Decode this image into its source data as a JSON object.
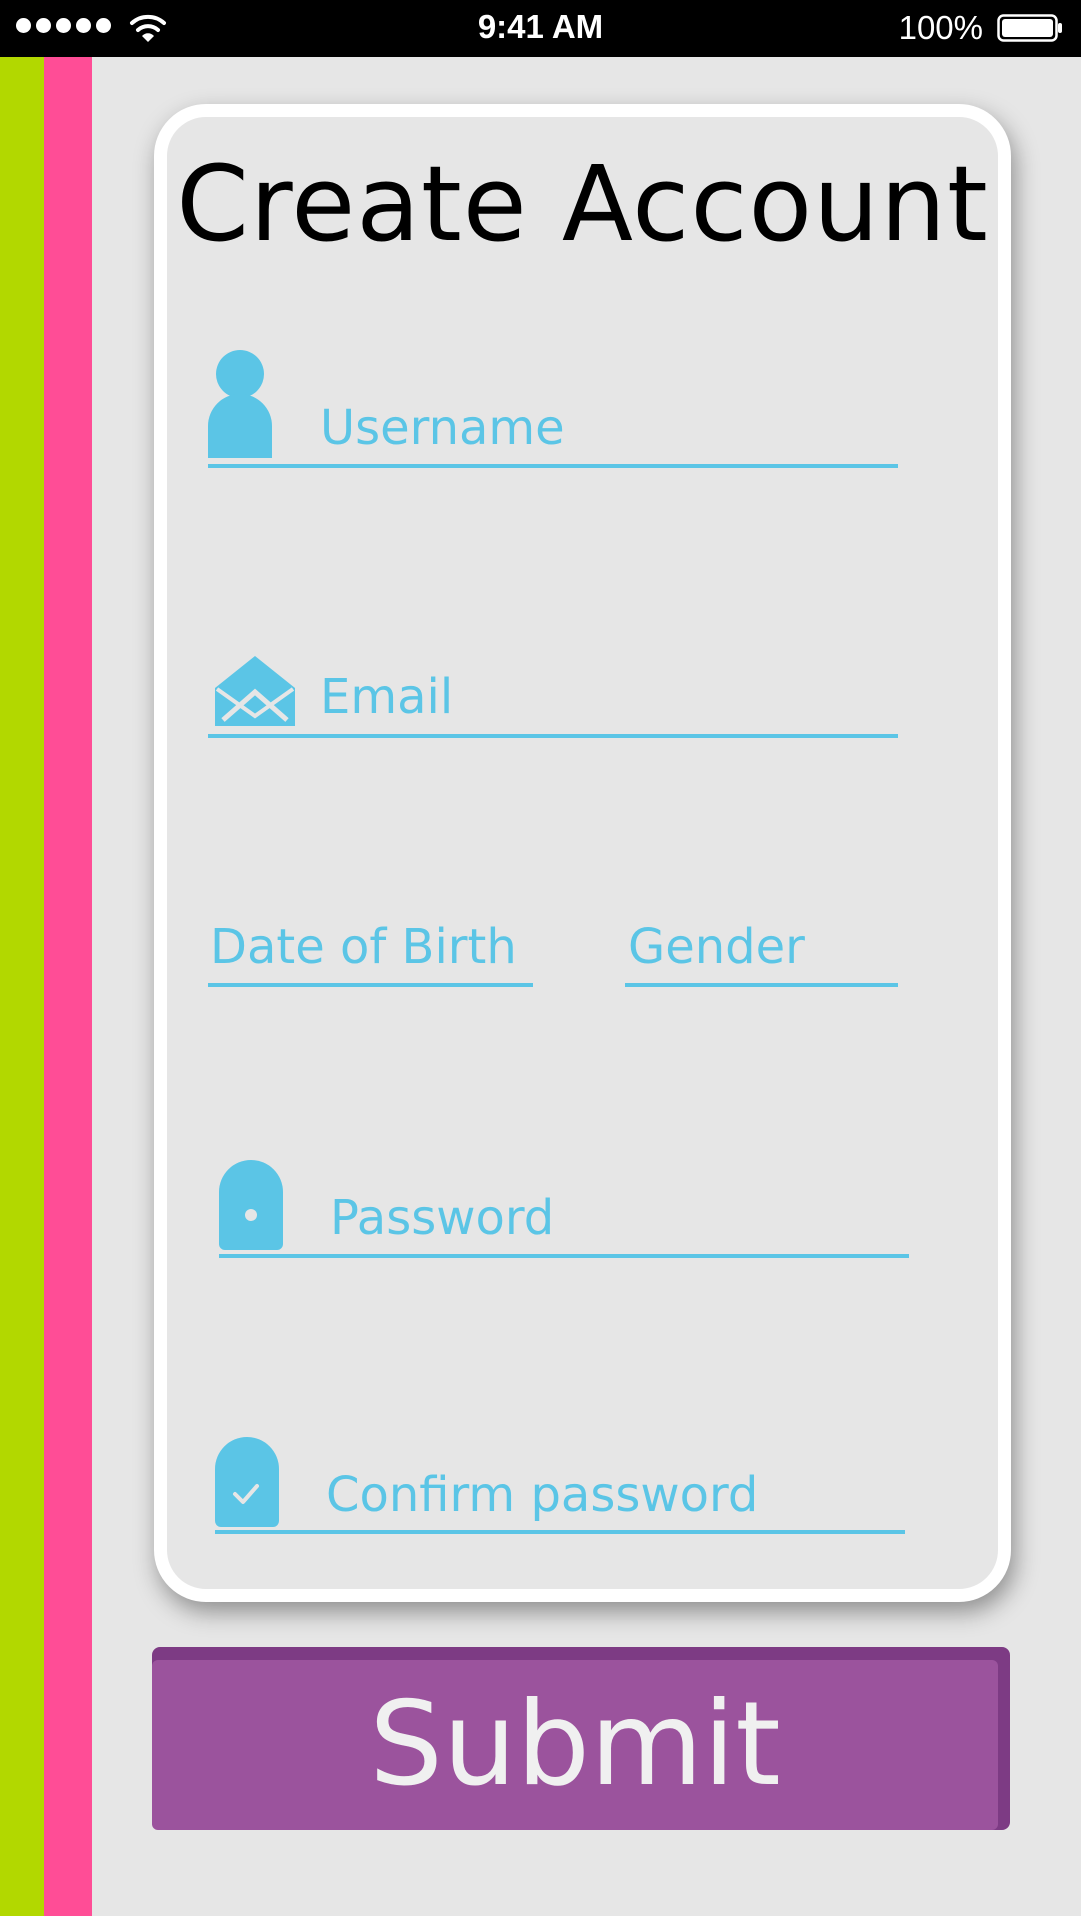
{
  "status_bar": {
    "time": "9:41 AM",
    "battery_percent": "100%",
    "icons": [
      "signal-dots-icon",
      "wifi-icon",
      "battery-icon"
    ]
  },
  "form": {
    "title": "Create Account",
    "username": {
      "placeholder": "Username",
      "icon": "user-icon"
    },
    "email": {
      "placeholder": "Email",
      "icon": "envelope-icon"
    },
    "date_of_birth": {
      "placeholder": "Date of Birth"
    },
    "gender": {
      "placeholder": "Gender"
    },
    "password": {
      "placeholder": "Password",
      "icon": "lock-icon"
    },
    "confirm_password": {
      "placeholder": "Confirm password",
      "icon": "lock-check-icon"
    },
    "submit_label": "Submit"
  },
  "colors": {
    "accent": "#5bc5e6",
    "submit": "#9b539d",
    "stripe_green": "#b2d800",
    "stripe_pink": "#ff4d96",
    "background": "#e6e6e6"
  }
}
